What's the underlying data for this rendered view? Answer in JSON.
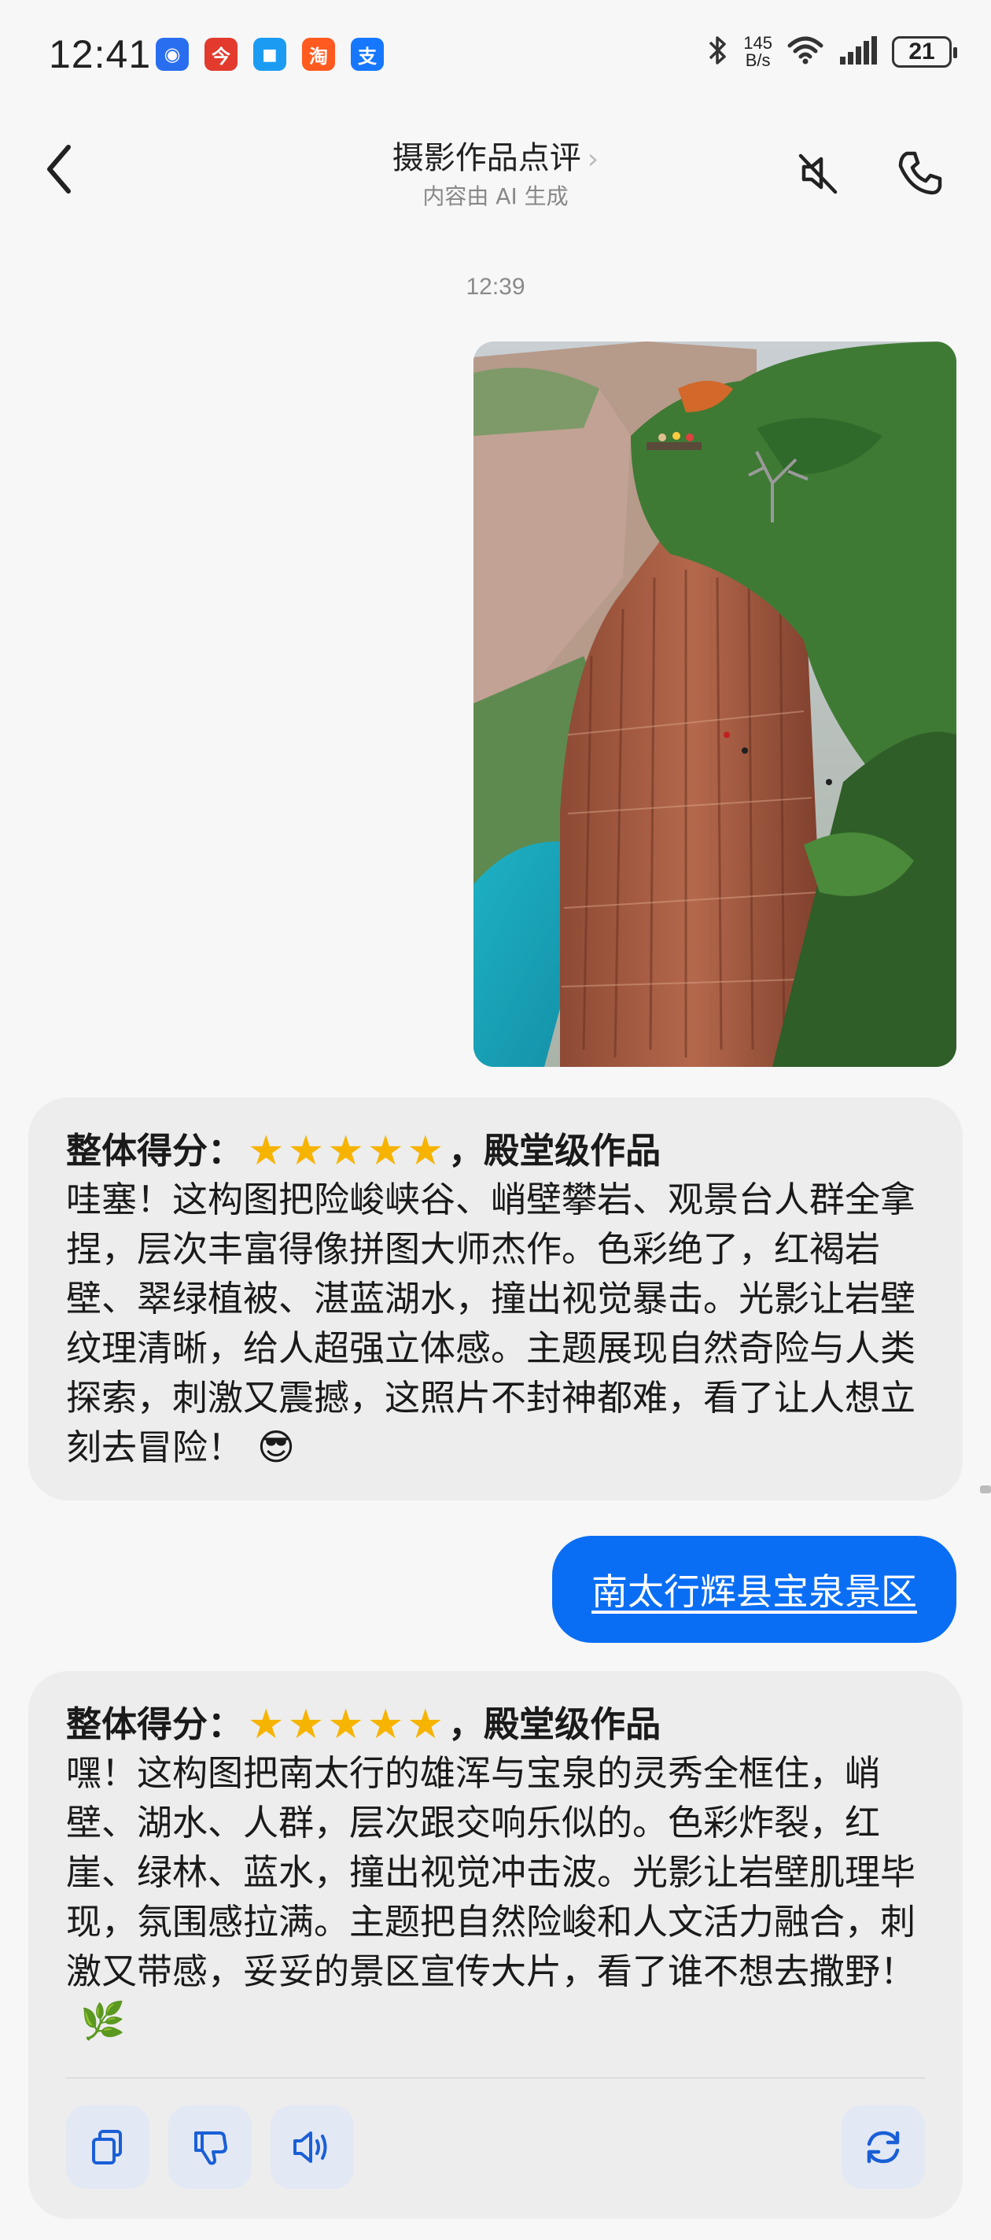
{
  "status_bar": {
    "time": "12:41",
    "net_speed_value": "145",
    "net_speed_unit": "B/s",
    "battery": "21",
    "app_icons": [
      "notify-app-icon",
      "news-app-icon",
      "message-app-icon",
      "taobao-app-icon",
      "alipay-app-icon"
    ],
    "app_glyphs": [
      "◉",
      "今",
      "◼",
      "淘",
      "支"
    ],
    "app_colors": [
      "#2a6ef0",
      "#e23b2e",
      "#1b9cf2",
      "#ff5a1f",
      "#1677ff"
    ]
  },
  "header": {
    "title": "摄影作品点评",
    "chevron": "›",
    "subtitle": "内容由 AI 生成"
  },
  "chat": {
    "timestamp": "12:39",
    "messages": [
      {
        "score_label": "整体得分：",
        "score_stars": 5,
        "score_suffix": "，殿堂级作品",
        "text": "哇塞！这构图把险峻峡谷、峭壁攀岩、观景台人群全拿捏，层次丰富得像拼图大师杰作。色彩绝了，红褐岩壁、翠绿植被、湛蓝湖水，撞出视觉暴击。光影让岩壁纹理清晰，给人超强立体感。主题展现自然奇险与人类探索，刺激又震撼，这照片不封神都难，看了让人想立刻去冒险！",
        "emoji": "😎"
      },
      {
        "user_text": "南太行辉县宝泉景区"
      },
      {
        "score_label": "整体得分：",
        "score_stars": 5,
        "score_suffix": "，殿堂级作品",
        "text": "嘿！这构图把南太行的雄浑与宝泉的灵秀全框住，峭壁、湖水、人群，层次跟交响乐似的。色彩炸裂，红崖、绿林、蓝水，撞出视觉冲击波。光影让岩壁肌理毕现，氛围感拉满。主题把自然险峻和人文活力融合，刺激又带感，妥妥的景区宣传大片，看了谁不想去撒野！",
        "emoji": "🌿"
      }
    ]
  },
  "actions": [
    "copy-icon",
    "dislike-icon",
    "speaker-icon",
    "regenerate-icon"
  ],
  "colors": {
    "accent": "#0a6ef5",
    "star": "#f6b400",
    "bubble": "#ededed"
  }
}
